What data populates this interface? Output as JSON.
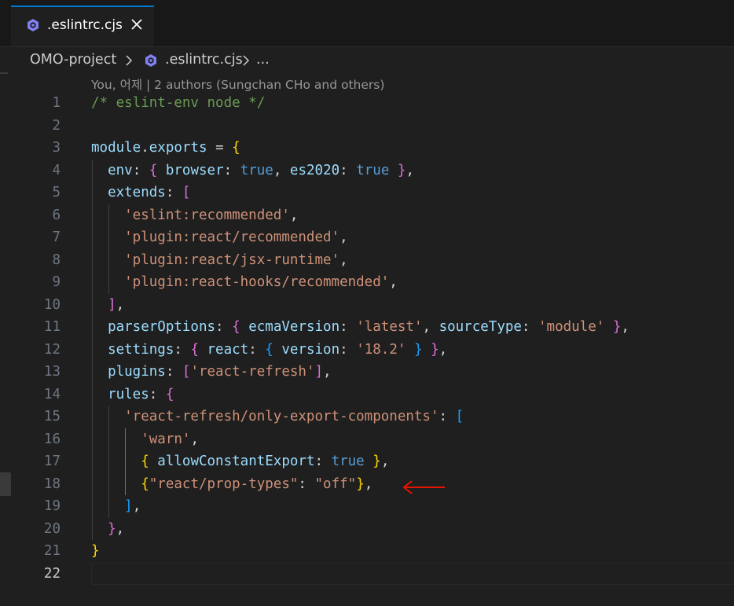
{
  "tab": {
    "label": ".eslintrc.cjs",
    "icon": "eslint-icon",
    "close_icon": "close-icon"
  },
  "breadcrumb": {
    "project": "OMO-project",
    "file": ".eslintrc.cjs",
    "more": "..."
  },
  "blame": "You, 어제 | 2 authors (Sungchan CHo and others)",
  "colors": {
    "background": "#1f1f1f",
    "accent": "#0078d4",
    "comment": "#6a9955",
    "property": "#9cdcfe",
    "string": "#ce9178",
    "keyword": "#569cd6",
    "bracket1": "#ffd700",
    "bracket2": "#da70d6",
    "bracket3": "#179fff",
    "annotation_arrow": "#e51400"
  },
  "line_numbers": [
    "1",
    "2",
    "3",
    "4",
    "5",
    "6",
    "7",
    "8",
    "9",
    "10",
    "11",
    "12",
    "13",
    "14",
    "15",
    "16",
    "17",
    "18",
    "19",
    "20",
    "21",
    "22"
  ],
  "active_line": "22",
  "code_lines": [
    [
      {
        "t": "/* eslint-env node */",
        "c": "comment"
      }
    ],
    [],
    [
      {
        "t": "module",
        "c": "var"
      },
      {
        "t": ".",
        "c": "punc"
      },
      {
        "t": "exports",
        "c": "var"
      },
      {
        "t": " = ",
        "c": "punc"
      },
      {
        "t": "{",
        "c": "b1"
      }
    ],
    [
      {
        "t": "  env",
        "c": "prop"
      },
      {
        "t": ": ",
        "c": "punc"
      },
      {
        "t": "{",
        "c": "b2"
      },
      {
        "t": " browser",
        "c": "prop"
      },
      {
        "t": ": ",
        "c": "punc"
      },
      {
        "t": "true",
        "c": "bool"
      },
      {
        "t": ", ",
        "c": "punc"
      },
      {
        "t": "es2020",
        "c": "prop"
      },
      {
        "t": ": ",
        "c": "punc"
      },
      {
        "t": "true",
        "c": "bool"
      },
      {
        "t": " ",
        "c": "punc"
      },
      {
        "t": "}",
        "c": "b2"
      },
      {
        "t": ",",
        "c": "punc"
      }
    ],
    [
      {
        "t": "  extends",
        "c": "prop"
      },
      {
        "t": ": ",
        "c": "punc"
      },
      {
        "t": "[",
        "c": "b2"
      }
    ],
    [
      {
        "t": "    'eslint:recommended'",
        "c": "str"
      },
      {
        "t": ",",
        "c": "punc"
      }
    ],
    [
      {
        "t": "    'plugin:react/recommended'",
        "c": "str"
      },
      {
        "t": ",",
        "c": "punc"
      }
    ],
    [
      {
        "t": "    'plugin:react/jsx-runtime'",
        "c": "str"
      },
      {
        "t": ",",
        "c": "punc"
      }
    ],
    [
      {
        "t": "    'plugin:react-hooks/recommended'",
        "c": "str"
      },
      {
        "t": ",",
        "c": "punc"
      }
    ],
    [
      {
        "t": "  ",
        "c": "punc"
      },
      {
        "t": "]",
        "c": "b2"
      },
      {
        "t": ",",
        "c": "punc"
      }
    ],
    [
      {
        "t": "  parserOptions",
        "c": "prop"
      },
      {
        "t": ": ",
        "c": "punc"
      },
      {
        "t": "{",
        "c": "b2"
      },
      {
        "t": " ecmaVersion",
        "c": "prop"
      },
      {
        "t": ": ",
        "c": "punc"
      },
      {
        "t": "'latest'",
        "c": "str"
      },
      {
        "t": ", ",
        "c": "punc"
      },
      {
        "t": "sourceType",
        "c": "prop"
      },
      {
        "t": ": ",
        "c": "punc"
      },
      {
        "t": "'module'",
        "c": "str"
      },
      {
        "t": " ",
        "c": "punc"
      },
      {
        "t": "}",
        "c": "b2"
      },
      {
        "t": ",",
        "c": "punc"
      }
    ],
    [
      {
        "t": "  settings",
        "c": "prop"
      },
      {
        "t": ": ",
        "c": "punc"
      },
      {
        "t": "{",
        "c": "b2"
      },
      {
        "t": " react",
        "c": "prop"
      },
      {
        "t": ": ",
        "c": "punc"
      },
      {
        "t": "{",
        "c": "b3"
      },
      {
        "t": " version",
        "c": "prop"
      },
      {
        "t": ": ",
        "c": "punc"
      },
      {
        "t": "'18.2'",
        "c": "str"
      },
      {
        "t": " ",
        "c": "punc"
      },
      {
        "t": "}",
        "c": "b3"
      },
      {
        "t": " ",
        "c": "punc"
      },
      {
        "t": "}",
        "c": "b2"
      },
      {
        "t": ",",
        "c": "punc"
      }
    ],
    [
      {
        "t": "  plugins",
        "c": "prop"
      },
      {
        "t": ": ",
        "c": "punc"
      },
      {
        "t": "[",
        "c": "b2"
      },
      {
        "t": "'react-refresh'",
        "c": "str"
      },
      {
        "t": "]",
        "c": "b2"
      },
      {
        "t": ",",
        "c": "punc"
      }
    ],
    [
      {
        "t": "  rules",
        "c": "prop"
      },
      {
        "t": ": ",
        "c": "punc"
      },
      {
        "t": "{",
        "c": "b2"
      }
    ],
    [
      {
        "t": "    'react-refresh/only-export-components'",
        "c": "str"
      },
      {
        "t": ": ",
        "c": "punc"
      },
      {
        "t": "[",
        "c": "b3"
      }
    ],
    [
      {
        "t": "      'warn'",
        "c": "str"
      },
      {
        "t": ",",
        "c": "punc"
      }
    ],
    [
      {
        "t": "      ",
        "c": "punc"
      },
      {
        "t": "{",
        "c": "b1"
      },
      {
        "t": " allowConstantExport",
        "c": "prop"
      },
      {
        "t": ": ",
        "c": "punc"
      },
      {
        "t": "true",
        "c": "bool"
      },
      {
        "t": " ",
        "c": "punc"
      },
      {
        "t": "}",
        "c": "b1"
      },
      {
        "t": ",",
        "c": "punc"
      }
    ],
    [
      {
        "t": "      ",
        "c": "punc"
      },
      {
        "t": "{",
        "c": "b1"
      },
      {
        "t": "\"react/prop-types\"",
        "c": "str"
      },
      {
        "t": ": ",
        "c": "punc"
      },
      {
        "t": "\"off\"",
        "c": "str"
      },
      {
        "t": "}",
        "c": "b1"
      },
      {
        "t": ",",
        "c": "punc"
      }
    ],
    [
      {
        "t": "    ",
        "c": "punc"
      },
      {
        "t": "]",
        "c": "b3"
      },
      {
        "t": ",",
        "c": "punc"
      }
    ],
    [
      {
        "t": "  ",
        "c": "punc"
      },
      {
        "t": "}",
        "c": "b2"
      },
      {
        "t": ",",
        "c": "punc"
      }
    ],
    [
      {
        "t": "}",
        "c": "b1"
      }
    ],
    []
  ]
}
